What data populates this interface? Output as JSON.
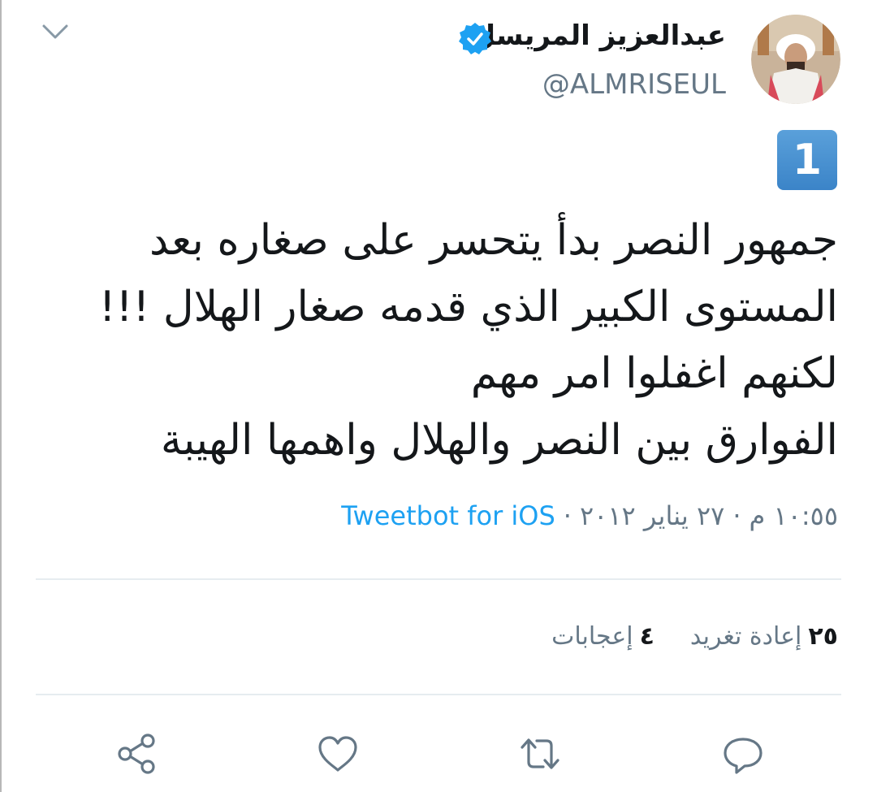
{
  "header": {
    "display_name": "عبدالعزيز المريسل",
    "handle": "@ALMRISEUL",
    "verified": true,
    "collapse_icon": "chevron-down-icon"
  },
  "tweet": {
    "number_badge": "1",
    "lines": [
      "جمهور النصر بدأ يتحسر على صغاره بعد",
      "المستوى الكبير الذي قدمه صغار الهلال !!!",
      "لكنهم اغفلوا امر مهم",
      "الفوارق بين النصر والهلال واهمها الهيبة"
    ],
    "time": "١٠:٥٥ م",
    "date": "٢٧ يناير ٢٠١٢",
    "separator": "·",
    "source": "Tweetbot for iOS"
  },
  "stats": {
    "retweets_count": "٢٥",
    "retweets_label": "إعادة تغريد",
    "likes_count": "٤",
    "likes_label": "إعجابات"
  },
  "actions": [
    "reply-icon",
    "retweet-icon",
    "like-icon",
    "share-icon"
  ],
  "colors": {
    "link": "#1da1f2",
    "secondary_text": "#657786",
    "primary_text": "#14171a",
    "divider": "#e6ecf0",
    "verified_badge": "#1da1f2"
  }
}
